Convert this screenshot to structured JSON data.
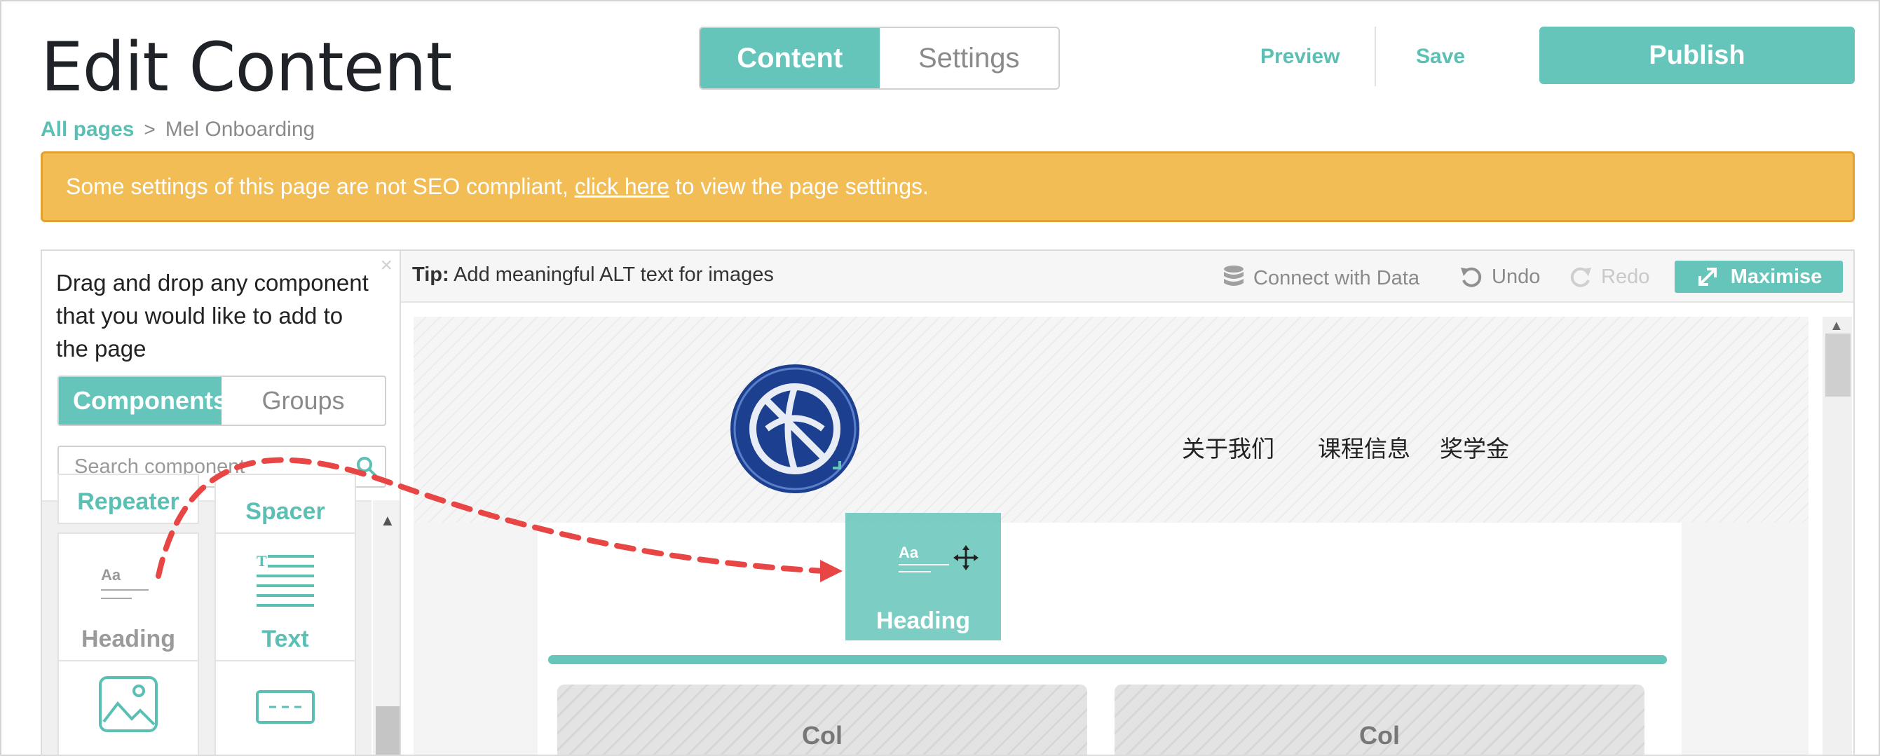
{
  "header": {
    "title": "Edit Content",
    "tabs": [
      {
        "label": "Content",
        "active": true
      },
      {
        "label": "Settings",
        "active": false
      }
    ],
    "preview_label": "Preview",
    "save_label": "Save",
    "publish_label": "Publish"
  },
  "breadcrumb": {
    "root": "All pages",
    "separator": ">",
    "current": "Mel Onboarding"
  },
  "alert": {
    "text_before": "Some settings of this page are not SEO compliant, ",
    "link": "click here",
    "text_after": " to view the page settings."
  },
  "left_panel": {
    "close": "×",
    "intro": "Drag and drop any component that you would like to add to the page",
    "tabs": [
      {
        "label": "Components",
        "active": true
      },
      {
        "label": "Groups",
        "active": false
      }
    ],
    "search_placeholder": "Search component",
    "components": [
      {
        "label": "Repeater",
        "icon": "repeater-icon"
      },
      {
        "label": "Spacer",
        "icon": "spacer-icon"
      },
      {
        "label": "Heading",
        "icon": "heading-icon"
      },
      {
        "label": "Text",
        "icon": "text-icon"
      },
      {
        "label": "",
        "icon": "image-icon"
      },
      {
        "label": "",
        "icon": "button-icon"
      }
    ]
  },
  "toolbar": {
    "tip_label": "Tip:",
    "tip_text": "Add meaningful ALT text for images",
    "connect_label": "Connect with Data",
    "undo_label": "Undo",
    "redo_label": "Redo",
    "maximise_label": "Maximise"
  },
  "canvas": {
    "nav_items": [
      "关于我们",
      "课程信息",
      "奖学金"
    ],
    "columns": [
      "Col",
      "Col"
    ],
    "drag_ghost": {
      "label": "Heading",
      "icon_text": "Aa"
    }
  },
  "colors": {
    "accent": "#65c5bb",
    "alert": "#f2bd55",
    "arrow": "#e84545",
    "logo": "#1d3f8f"
  }
}
